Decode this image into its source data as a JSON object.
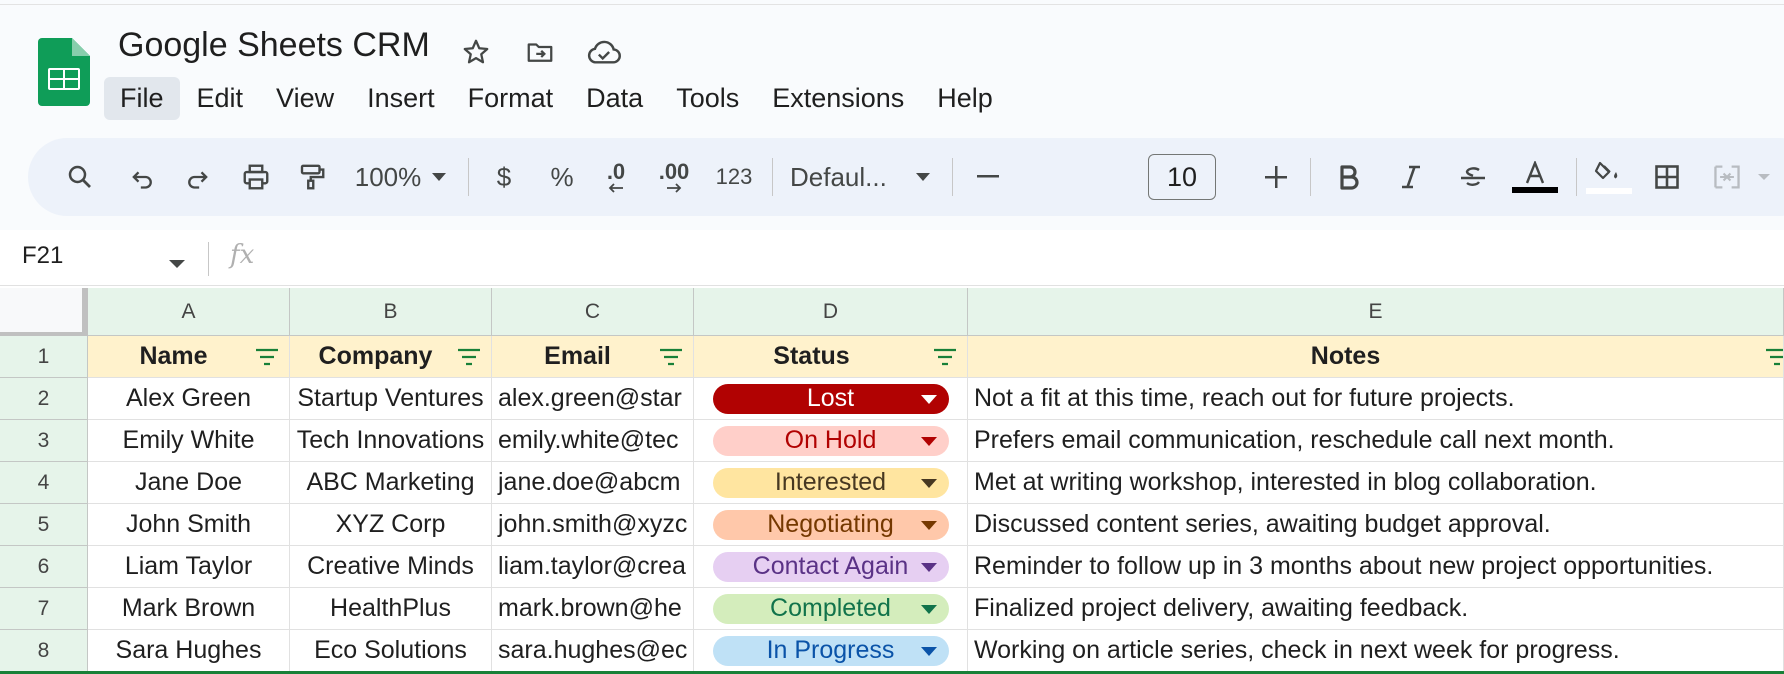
{
  "document": {
    "title": "Google Sheets CRM"
  },
  "menu": [
    "File",
    "Edit",
    "View",
    "Insert",
    "Format",
    "Data",
    "Tools",
    "Extensions",
    "Help"
  ],
  "toolbar": {
    "zoom": "100%",
    "currency": "$",
    "percent": "%",
    "decrease_decimal": ".0",
    "increase_decimal": ".00",
    "number_format": "123",
    "font": "Defaul...",
    "font_size": "10"
  },
  "formula_bar": {
    "cell_ref": "F21",
    "fx": "fx",
    "value": ""
  },
  "columns": [
    "A",
    "B",
    "C",
    "D",
    "E"
  ],
  "rows": [
    "1",
    "2",
    "3",
    "4",
    "5",
    "6",
    "7",
    "8"
  ],
  "headers": [
    "Name",
    "Company",
    "Email",
    "Status",
    "Notes"
  ],
  "records": [
    {
      "name": "Alex Green",
      "company": "Startup Ventures",
      "email": "alex.green@star",
      "status": "Lost",
      "notes": "Not a fit at this time, reach out for future projects."
    },
    {
      "name": "Emily White",
      "company": "Tech Innovations",
      "email": "emily.white@tec",
      "status": "On Hold",
      "notes": "Prefers email communication, reschedule call next month."
    },
    {
      "name": "Jane Doe",
      "company": "ABC Marketing",
      "email": "jane.doe@abcm",
      "status": "Interested",
      "notes": "Met at writing workshop, interested in blog collaboration."
    },
    {
      "name": "John Smith",
      "company": "XYZ Corp",
      "email": "john.smith@xyzc",
      "status": "Negotiating",
      "notes": "Discussed content series, awaiting budget approval."
    },
    {
      "name": "Liam Taylor",
      "company": "Creative Minds",
      "email": "liam.taylor@crea",
      "status": "Contact Again",
      "notes": "Reminder to follow up in 3 months about new project opportunities."
    },
    {
      "name": "Mark Brown",
      "company": "HealthPlus",
      "email": "mark.brown@he",
      "status": "Completed",
      "notes": "Finalized project delivery, awaiting feedback."
    },
    {
      "name": "Sara Hughes",
      "company": "Eco Solutions",
      "email": "sara.hughes@ec",
      "status": "In Progress",
      "notes": "Working on article series, check in next week for progress."
    }
  ],
  "status_colors": {
    "Lost": {
      "bg": "#b10202",
      "fg": "#ffffff"
    },
    "On Hold": {
      "bg": "#ffcfc9",
      "fg": "#b10202"
    },
    "Interested": {
      "bg": "#ffe5a0",
      "fg": "#473821"
    },
    "Negotiating": {
      "bg": "#ffc8aa",
      "fg": "#753800"
    },
    "Contact Again": {
      "bg": "#e6cff2",
      "fg": "#5a3286"
    },
    "Completed": {
      "bg": "#d4edbc",
      "fg": "#11734b"
    },
    "In Progress": {
      "bg": "#bfe1f6",
      "fg": "#0a53a8"
    }
  }
}
